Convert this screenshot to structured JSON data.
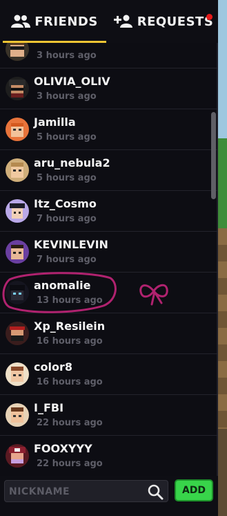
{
  "tabs": [
    {
      "label": "FRIENDS",
      "icon": "friends-icon",
      "active": true
    },
    {
      "label": "REQUESTS",
      "icon": "add-friend-icon",
      "has_notification": true
    }
  ],
  "friends": [
    {
      "name": "",
      "time": "3 hours ago"
    },
    {
      "name": "OLIVIA_OLIV",
      "time": "3 hours ago"
    },
    {
      "name": "Jamilla",
      "time": "5 hours ago"
    },
    {
      "name": "aru_nebula2",
      "time": "5 hours ago"
    },
    {
      "name": "Itz_Cosmo",
      "time": "7 hours ago"
    },
    {
      "name": "KEVINLEVIN",
      "time": "7 hours ago"
    },
    {
      "name": "anomalie",
      "time": "13 hours ago"
    },
    {
      "name": "Xp_Resilein",
      "time": "16 hours ago"
    },
    {
      "name": "color8",
      "time": "16 hours ago"
    },
    {
      "name": "I_FBI",
      "time": "22 hours ago"
    },
    {
      "name": "FOOXYYY",
      "time": "22 hours ago"
    }
  ],
  "search": {
    "placeholder": "NICKNAME",
    "icon": "search-icon"
  },
  "add_button": {
    "label": "ADD"
  },
  "colors": {
    "accent": "#f0c533",
    "add": "#38d44a",
    "badge": "#e51a1a",
    "annotation": "#b0226f"
  }
}
